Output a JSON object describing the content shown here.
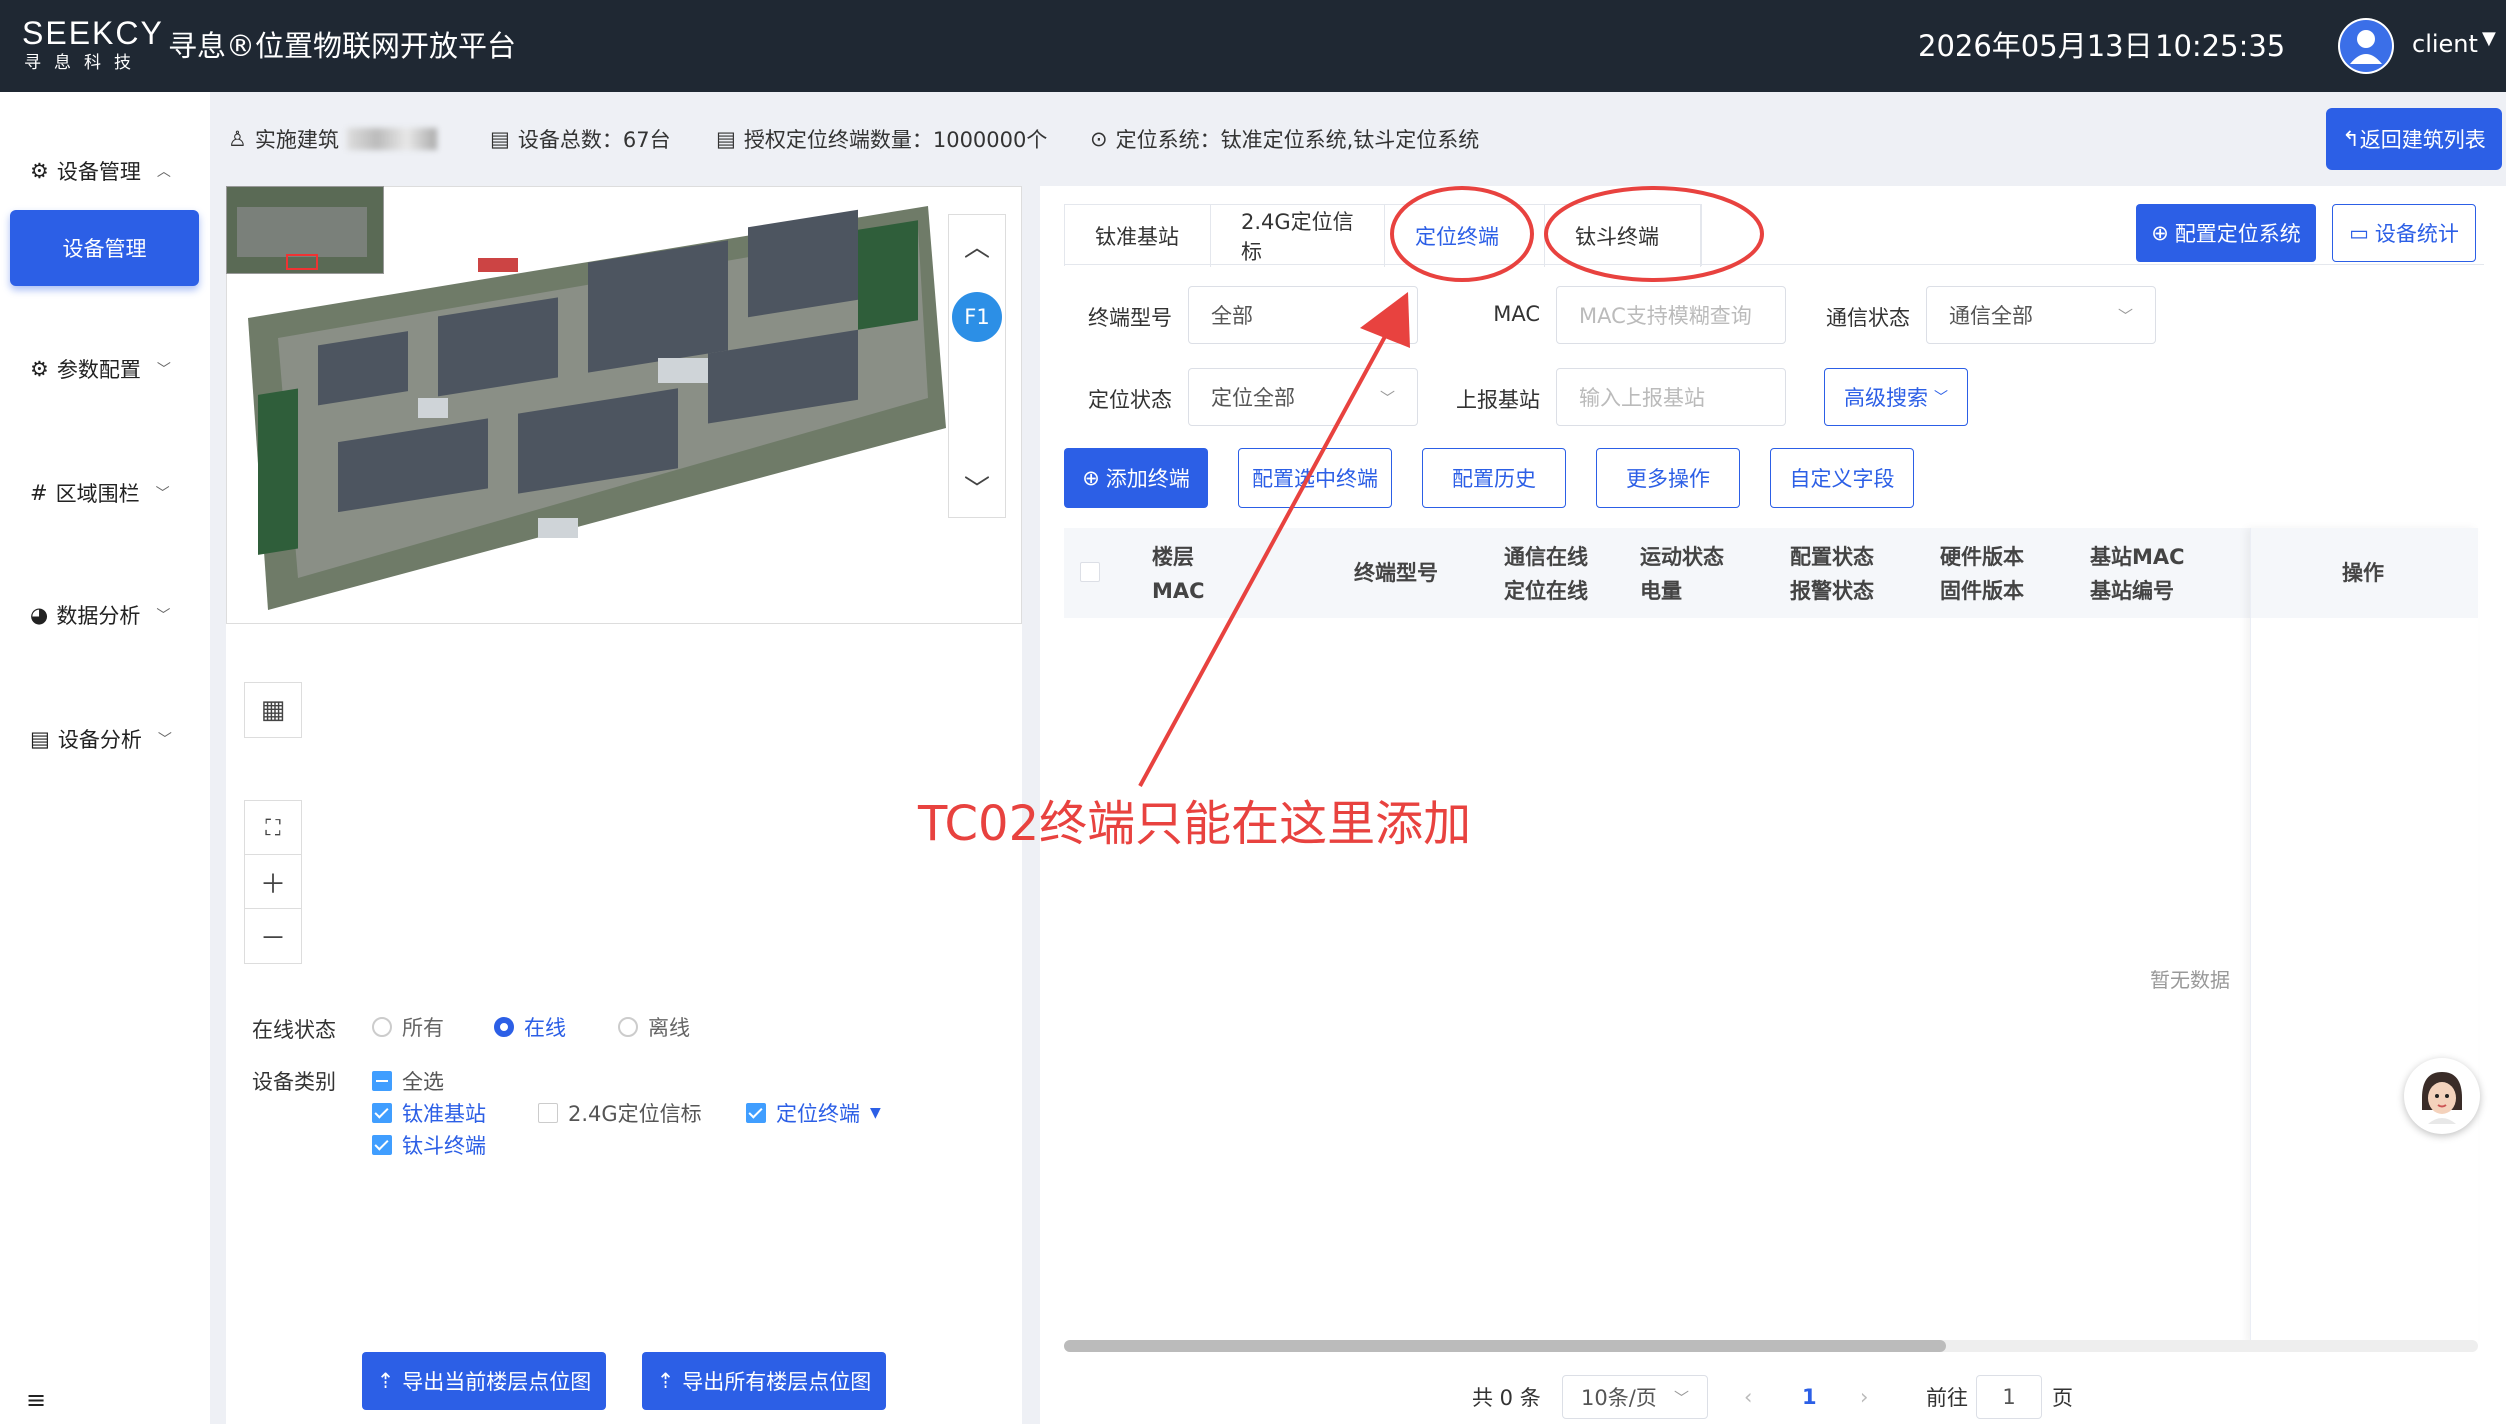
{
  "header": {
    "logo_main": "SEEKCY",
    "logo_sub": "寻息科技",
    "app_title": "寻息®位置物联网开放平台",
    "date": "2026年05月13日",
    "time": "10:25:35",
    "username": "client"
  },
  "sidebar": {
    "items": [
      {
        "label": "设备管理",
        "icon": "gear-icon"
      },
      {
        "label": "设备管理"
      },
      {
        "label": "参数配置",
        "icon": "gears-icon"
      },
      {
        "label": "区域围栏",
        "icon": "grid-fence-icon"
      },
      {
        "label": "数据分析",
        "icon": "pie-chart-icon"
      },
      {
        "label": "设备分析",
        "icon": "device-chart-icon"
      }
    ]
  },
  "infobar": {
    "building": "实施建筑",
    "device_total": "设备总数：67台",
    "license": "授权定位终端数量：1000000个",
    "system": "定位系统：钛准定位系统,钛斗定位系统",
    "back_button": "返回建筑列表"
  },
  "map": {
    "floor": "F1"
  },
  "filters": {
    "online_label": "在线状态",
    "online_options": [
      {
        "label": "所有",
        "checked": false
      },
      {
        "label": "在线",
        "checked": true
      },
      {
        "label": "离线",
        "checked": false
      }
    ],
    "category_label": "设备类别",
    "categories": [
      {
        "label": "全选",
        "state": "indeterminate"
      },
      {
        "label": "钛准基站",
        "state": "checked"
      },
      {
        "label": "2.4G定位信标",
        "state": "unchecked"
      },
      {
        "label": "定位终端",
        "state": "checked"
      },
      {
        "label": "钛斗终端",
        "state": "checked"
      }
    ]
  },
  "export": {
    "current": "导出当前楼层点位图",
    "all": "导出所有楼层点位图"
  },
  "tabs": [
    "钛准基站",
    "2.4G定位信标",
    "定位终端",
    "钛斗终端"
  ],
  "active_tab": "定位终端",
  "top_buttons": {
    "config_system": "配置定位系统",
    "device_stats": "设备统计"
  },
  "form": {
    "model_label": "终端型号",
    "model_value": "全部",
    "mac_label": "MAC",
    "mac_placeholder": "MAC支持模糊查询",
    "comm_label": "通信状态",
    "comm_value": "通信全部",
    "pos_label": "定位状态",
    "pos_value": "定位全部",
    "station_label": "上报基站",
    "station_placeholder": "输入上报基站",
    "advanced": "高级搜索"
  },
  "actions": {
    "add": "添加终端",
    "config_selected": "配置选中终端",
    "history": "配置历史",
    "more": "更多操作",
    "custom": "自定义字段"
  },
  "table": {
    "columns": [
      [
        "楼层",
        "MAC"
      ],
      [
        "终端型号"
      ],
      [
        "通信在线",
        "定位在线"
      ],
      [
        "运动状态",
        "电量"
      ],
      [
        "配置状态",
        "报警状态"
      ],
      [
        "硬件版本",
        "固件版本"
      ],
      [
        "基站MAC",
        "基站编号"
      ],
      [
        "操作"
      ]
    ],
    "empty_text": "暂无数据"
  },
  "pagination": {
    "total": "共 0 条",
    "page_size": "10条/页",
    "current_page": "1",
    "goto_label": "前往",
    "goto_value": "1",
    "page_suffix": "页"
  },
  "annotation": {
    "text": "TC02终端只能在这里添加",
    "color": "#e8423f"
  },
  "colors": {
    "primary": "#2c5fe6",
    "header_bg": "#1f2833"
  }
}
